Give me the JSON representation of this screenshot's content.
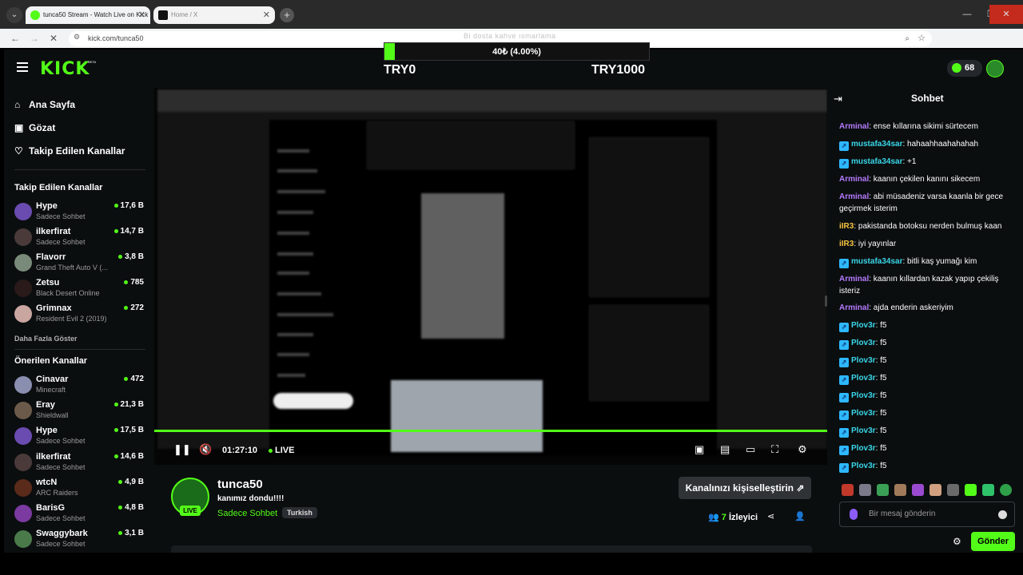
{
  "browser": {
    "tabs": [
      {
        "title": "tunca50 Stream - Watch Live on Kick",
        "active": true
      },
      {
        "title": "Home / X",
        "active": false
      }
    ],
    "url": "kick.com/tunca50",
    "window_controls": [
      "—",
      "❐",
      "✕"
    ]
  },
  "overlay": {
    "title": "Bi dosta kahve ısmarlama",
    "goal_text": "40₺ (4.00%)",
    "goal_percent": 4.0,
    "min_label": "TRY0",
    "max_label": "TRY1000"
  },
  "header": {
    "logo": "KICK",
    "logo_badge": "BETA",
    "points": "68"
  },
  "sidebar": {
    "nav": [
      {
        "label": "Ana Sayfa",
        "icon": "home-icon"
      },
      {
        "label": "Gözat",
        "icon": "browse-icon"
      },
      {
        "label": "Takip Edilen Kanallar",
        "icon": "heart-icon"
      }
    ],
    "followed_title": "Takip Edilen Kanallar",
    "followed": [
      {
        "name": "Hype",
        "category": "Sadece Sohbet",
        "viewers": "17,6 B"
      },
      {
        "name": "ilkerfirat",
        "category": "Sadece Sohbet",
        "viewers": "14,7 B"
      },
      {
        "name": "Flavorr",
        "category": "Grand Theft Auto V (...",
        "viewers": "3,8 B"
      },
      {
        "name": "Zetsu",
        "category": "Black Desert Online",
        "viewers": "785"
      },
      {
        "name": "Grimnax",
        "category": "Resident Evil 2 (2019)",
        "viewers": "272"
      }
    ],
    "show_more": "Daha Fazla Göster",
    "recommended_title": "Önerilen Kanallar",
    "recommended": [
      {
        "name": "Cinavar",
        "category": "Minecraft",
        "viewers": "472"
      },
      {
        "name": "Eray",
        "category": "Shieldwall",
        "viewers": "21,3 B"
      },
      {
        "name": "Hype",
        "category": "Sadece Sohbet",
        "viewers": "17,5 B"
      },
      {
        "name": "ilkerfirat",
        "category": "Sadece Sohbet",
        "viewers": "14,6 B"
      },
      {
        "name": "wtcN",
        "category": "ARC Raiders",
        "viewers": "4,9 B"
      },
      {
        "name": "BarisG",
        "category": "Sadece Sohbet",
        "viewers": "4,8 B"
      },
      {
        "name": "Swaggybark",
        "category": "Sadece Sohbet",
        "viewers": "3,1 B"
      }
    ]
  },
  "player": {
    "time": "01:27:10",
    "live_label": "LIVE"
  },
  "channel": {
    "name": "tunca50",
    "title": "kanımız dondu!!!!",
    "category": "Sadece Sohbet",
    "tag": "Turkish",
    "live_badge": "LIVE",
    "customize_label": "Kanalınızı kişiselleştirin",
    "viewer_count": "7",
    "viewer_label": "İzleyici"
  },
  "chat": {
    "title": "Sohbet",
    "messages": [
      {
        "user": "Arminal",
        "text": "ense kıllarına sikimi sürtecem",
        "color": "#b57bff",
        "badge": false
      },
      {
        "user": "mustafa34sar",
        "text": "hahaahhaahahahah",
        "color": "#3ad6e8",
        "badge": true
      },
      {
        "user": "mustafa34sar",
        "text": "+1",
        "color": "#3ad6e8",
        "badge": true
      },
      {
        "user": "Arminal",
        "text": "kaanın çekilen kanını sikecem",
        "color": "#b57bff",
        "badge": false
      },
      {
        "user": "Arminal",
        "text": "abi müsadeniz varsa kaanla bir gece geçirmek isterim",
        "color": "#b57bff",
        "badge": false
      },
      {
        "user": "iIR3",
        "text": "pakistanda botoksu nerden bulmuş kaan",
        "color": "#f5c542",
        "badge": false
      },
      {
        "user": "iIR3",
        "text": "iyi yayınlar",
        "color": "#f5c542",
        "badge": false
      },
      {
        "user": "mustafa34sar",
        "text": "bitli kaş yumağı kim",
        "color": "#3ad6e8",
        "badge": true
      },
      {
        "user": "Arminal",
        "text": "kaanın kıllardan kazak yapıp çekiliş isteriz",
        "color": "#b57bff",
        "badge": false
      },
      {
        "user": "Arminal",
        "text": "ajda enderin askeriyim",
        "color": "#b57bff",
        "badge": false
      },
      {
        "user": "Plov3r",
        "text": "f5",
        "color": "#3ad6e8",
        "badge": true
      },
      {
        "user": "Plov3r",
        "text": "f5",
        "color": "#3ad6e8",
        "badge": true
      },
      {
        "user": "Plov3r",
        "text": "f5",
        "color": "#3ad6e8",
        "badge": true
      },
      {
        "user": "Plov3r",
        "text": "f5",
        "color": "#3ad6e8",
        "badge": true
      },
      {
        "user": "Plov3r",
        "text": "f5",
        "color": "#3ad6e8",
        "badge": true
      },
      {
        "user": "Plov3r",
        "text": "f5",
        "color": "#3ad6e8",
        "badge": true
      },
      {
        "user": "Plov3r",
        "text": "f5",
        "color": "#3ad6e8",
        "badge": true
      },
      {
        "user": "Plov3r",
        "text": "f5",
        "color": "#3ad6e8",
        "badge": true
      },
      {
        "user": "Plov3r",
        "text": "f5",
        "color": "#3ad6e8",
        "badge": true
      }
    ],
    "input_placeholder": "Bir mesaj gönderin",
    "send_label": "Gönder"
  },
  "colors": {
    "accent": "#53fc18",
    "background": "#0b0e0f"
  }
}
